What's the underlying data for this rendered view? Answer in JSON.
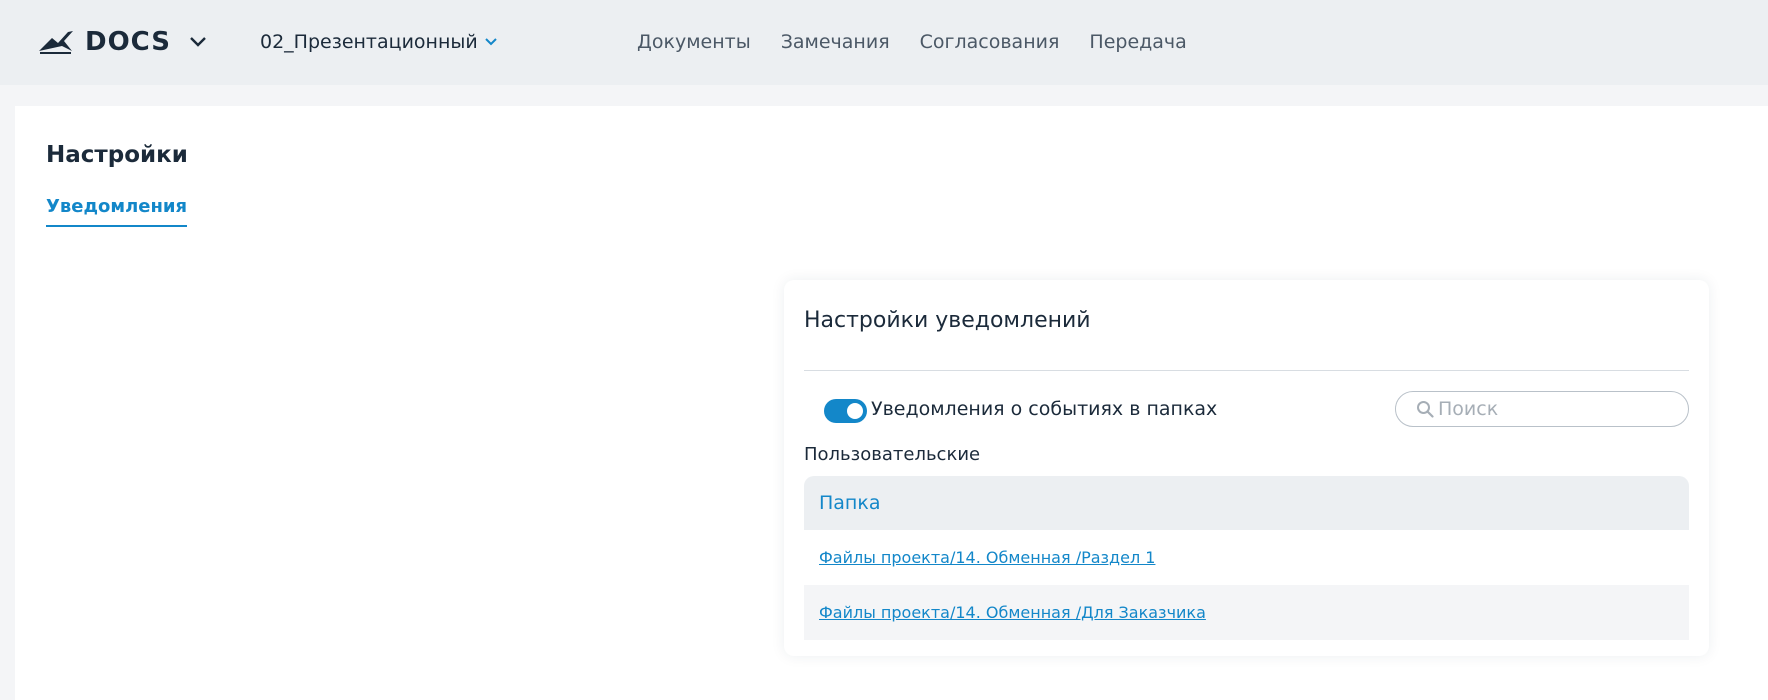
{
  "header": {
    "brand": "DOCS",
    "project": "02_Презентационный",
    "nav": [
      "Документы",
      "Замечания",
      "Согласования",
      "Передача"
    ]
  },
  "page": {
    "title": "Настройки",
    "tab": "Уведомления"
  },
  "card": {
    "title": "Настройки уведомлений",
    "toggle_label": "Уведомления о событиях в папках",
    "toggle_on": true,
    "search_placeholder": "Поиск",
    "group_label": "Пользовательские",
    "table": {
      "column": "Папка",
      "rows": [
        "Файлы проекта/14. Обменная /Раздел 1",
        "Файлы проекта/14. Обменная /Для Заказчика"
      ]
    }
  },
  "colors": {
    "accent": "#1387c9",
    "header_bg": "#eceff2",
    "text_dark": "#1b2a3a"
  }
}
